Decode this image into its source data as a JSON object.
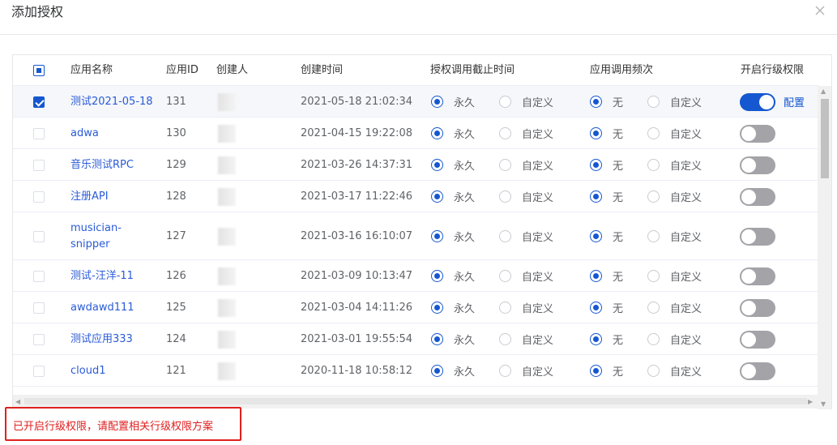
{
  "dialog": {
    "title": "添加授权"
  },
  "columns": {
    "name": "应用名称",
    "id": "应用ID",
    "creator": "创建人",
    "created": "创建时间",
    "expire": "授权调用截止时间",
    "freq": "应用调用频次",
    "tier": "开启行级权限"
  },
  "option_labels": {
    "forever": "永久",
    "custom": "自定义",
    "none": "无",
    "config": "配置"
  },
  "rows": [
    {
      "name": "测试2021-05-18",
      "id": "131",
      "created": "2021-05-18 21:02:34",
      "selected": true,
      "tier_on": true
    },
    {
      "name": "adwa",
      "id": "130",
      "created": "2021-04-15 19:22:08",
      "selected": false,
      "tier_on": false
    },
    {
      "name": "音乐测试RPC",
      "id": "129",
      "created": "2021-03-26 14:37:31",
      "selected": false,
      "tier_on": false
    },
    {
      "name": "注册API",
      "id": "128",
      "created": "2021-03-17 11:22:46",
      "selected": false,
      "tier_on": false
    },
    {
      "name": "musician-snipper",
      "id": "127",
      "created": "2021-03-16 16:10:07",
      "selected": false,
      "tier_on": false
    },
    {
      "name": "测试-汪洋-11",
      "id": "126",
      "created": "2021-03-09 10:13:47",
      "selected": false,
      "tier_on": false
    },
    {
      "name": "awdawd111",
      "id": "125",
      "created": "2021-03-04 14:11:26",
      "selected": false,
      "tier_on": false
    },
    {
      "name": "测试应用333",
      "id": "124",
      "created": "2021-03-01 19:55:54",
      "selected": false,
      "tier_on": false
    },
    {
      "name": "cloud1",
      "id": "121",
      "created": "2020-11-18 10:58:12",
      "selected": false,
      "tier_on": false
    }
  ],
  "notice": "已开启行级权限，请配置相关行级权限方案",
  "colors": {
    "accent": "#1557d0",
    "danger": "#e02020",
    "link": "#2a5bd7"
  }
}
